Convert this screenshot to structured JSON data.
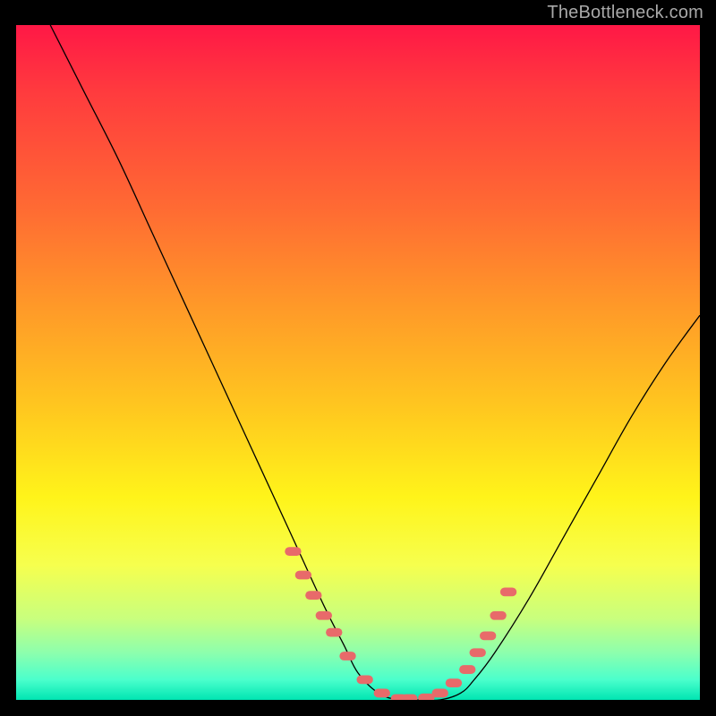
{
  "watermark": "TheBottleneck.com",
  "colors": {
    "curve_stroke": "#000000",
    "dot_fill": "#e86a6a",
    "background_black": "#000000"
  },
  "chart_data": {
    "type": "line",
    "title": "",
    "xlabel": "",
    "ylabel": "",
    "xlim": [
      0,
      100
    ],
    "ylim": [
      0,
      100
    ],
    "note": "Axes, units, and ticks are not shown; values are approximate percentages of the plot area inferred from the figure geometry.",
    "series": [
      {
        "name": "curve",
        "x": [
          5,
          10,
          15,
          20,
          25,
          30,
          35,
          40,
          45,
          48,
          50,
          53,
          56,
          59,
          62,
          65,
          67,
          70,
          75,
          80,
          85,
          90,
          95,
          100
        ],
        "y": [
          100,
          90,
          80,
          69,
          58,
          47,
          36,
          25,
          14,
          8,
          4,
          1,
          0,
          0,
          0,
          1,
          3,
          7,
          15,
          24,
          33,
          42,
          50,
          57
        ]
      },
      {
        "name": "highlight-dots",
        "x": [
          40.5,
          42,
          43.5,
          45,
          46.5,
          48.5,
          51,
          53.5,
          56,
          57.5,
          60,
          62,
          64,
          66,
          67.5,
          69,
          70.5,
          72
        ],
        "y": [
          22,
          18.5,
          15.5,
          12.5,
          10,
          6.5,
          3,
          1,
          0.2,
          0.2,
          0.3,
          1,
          2.5,
          4.5,
          7,
          9.5,
          12.5,
          16
        ]
      }
    ]
  }
}
